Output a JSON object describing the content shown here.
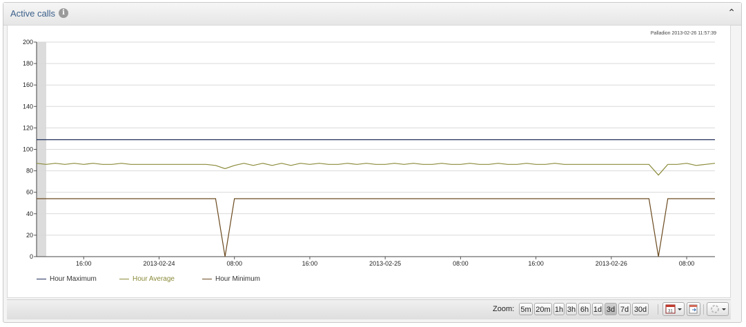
{
  "panel": {
    "title": "Active calls",
    "info_icon": "info-icon",
    "collapse_icon": "chevron-up-icon"
  },
  "chart_data": {
    "type": "line",
    "watermark": "Palladion 2013-02-26 11:57:39",
    "ylim": [
      0,
      200
    ],
    "yticks": [
      "0",
      "20",
      "40",
      "60",
      "80",
      "100",
      "120",
      "140",
      "160",
      "180",
      "200"
    ],
    "xtick_labels": [
      "16:00",
      "2013-02-24",
      "08:00",
      "16:00",
      "2013-02-25",
      "08:00",
      "16:00",
      "2013-02-26",
      "08:00"
    ],
    "xlim_hours": [
      -13,
      59
    ],
    "xtick_hours": [
      -8,
      0,
      8,
      16,
      24,
      32,
      40,
      48,
      56
    ],
    "series": [
      {
        "name": "Hour Maximum",
        "color": "#1f2d5a",
        "points": [
          [
            -13,
            109
          ],
          [
            59,
            109
          ]
        ]
      },
      {
        "name": "Hour Average",
        "color": "#8a8a3a",
        "points": [
          [
            -13,
            87
          ],
          [
            -12,
            86
          ],
          [
            -11,
            87
          ],
          [
            -10,
            86
          ],
          [
            -9,
            87
          ],
          [
            -8,
            86
          ],
          [
            -7,
            87
          ],
          [
            -6,
            86
          ],
          [
            -5,
            86
          ],
          [
            -4,
            87
          ],
          [
            -3,
            86
          ],
          [
            -2,
            86
          ],
          [
            -1,
            86
          ],
          [
            0,
            86
          ],
          [
            1,
            86
          ],
          [
            2,
            86
          ],
          [
            3,
            86
          ],
          [
            4,
            86
          ],
          [
            5,
            86
          ],
          [
            6,
            85
          ],
          [
            7,
            82
          ],
          [
            8,
            85
          ],
          [
            9,
            87
          ],
          [
            10,
            85
          ],
          [
            11,
            87
          ],
          [
            12,
            85
          ],
          [
            13,
            87
          ],
          [
            14,
            85
          ],
          [
            15,
            87
          ],
          [
            16,
            86
          ],
          [
            17,
            87
          ],
          [
            18,
            86
          ],
          [
            19,
            86
          ],
          [
            20,
            87
          ],
          [
            21,
            86
          ],
          [
            22,
            87
          ],
          [
            23,
            86
          ],
          [
            24,
            86
          ],
          [
            25,
            87
          ],
          [
            26,
            86
          ],
          [
            27,
            87
          ],
          [
            28,
            86
          ],
          [
            29,
            86
          ],
          [
            30,
            87
          ],
          [
            31,
            86
          ],
          [
            32,
            86
          ],
          [
            33,
            87
          ],
          [
            34,
            86
          ],
          [
            35,
            86
          ],
          [
            36,
            87
          ],
          [
            37,
            86
          ],
          [
            38,
            86
          ],
          [
            39,
            87
          ],
          [
            40,
            86
          ],
          [
            41,
            86
          ],
          [
            42,
            87
          ],
          [
            43,
            86
          ],
          [
            44,
            86
          ],
          [
            45,
            86
          ],
          [
            46,
            86
          ],
          [
            47,
            86
          ],
          [
            48,
            86
          ],
          [
            49,
            86
          ],
          [
            50,
            86
          ],
          [
            51,
            86
          ],
          [
            52,
            86
          ],
          [
            53,
            76
          ],
          [
            54,
            86
          ],
          [
            55,
            86
          ],
          [
            56,
            87
          ],
          [
            57,
            85
          ],
          [
            58,
            86
          ],
          [
            59,
            87
          ]
        ]
      },
      {
        "name": "Hour Minimum",
        "color": "#6b4a1f",
        "points": [
          [
            -13,
            54
          ],
          [
            6,
            54
          ],
          [
            7,
            0
          ],
          [
            8,
            54
          ],
          [
            52,
            54
          ],
          [
            53,
            0
          ],
          [
            54,
            54
          ],
          [
            59,
            54
          ]
        ]
      }
    ]
  },
  "footer": {
    "zoom_label": "Zoom:",
    "zoom_options": [
      "5m",
      "20m",
      "1h",
      "3h",
      "6h",
      "1d",
      "3d",
      "7d",
      "30d"
    ],
    "active_zoom": "3d",
    "calendar_day": "31",
    "tool_icons": [
      "calendar-dropdown-icon",
      "export-icon",
      "refresh-dropdown-icon"
    ]
  }
}
